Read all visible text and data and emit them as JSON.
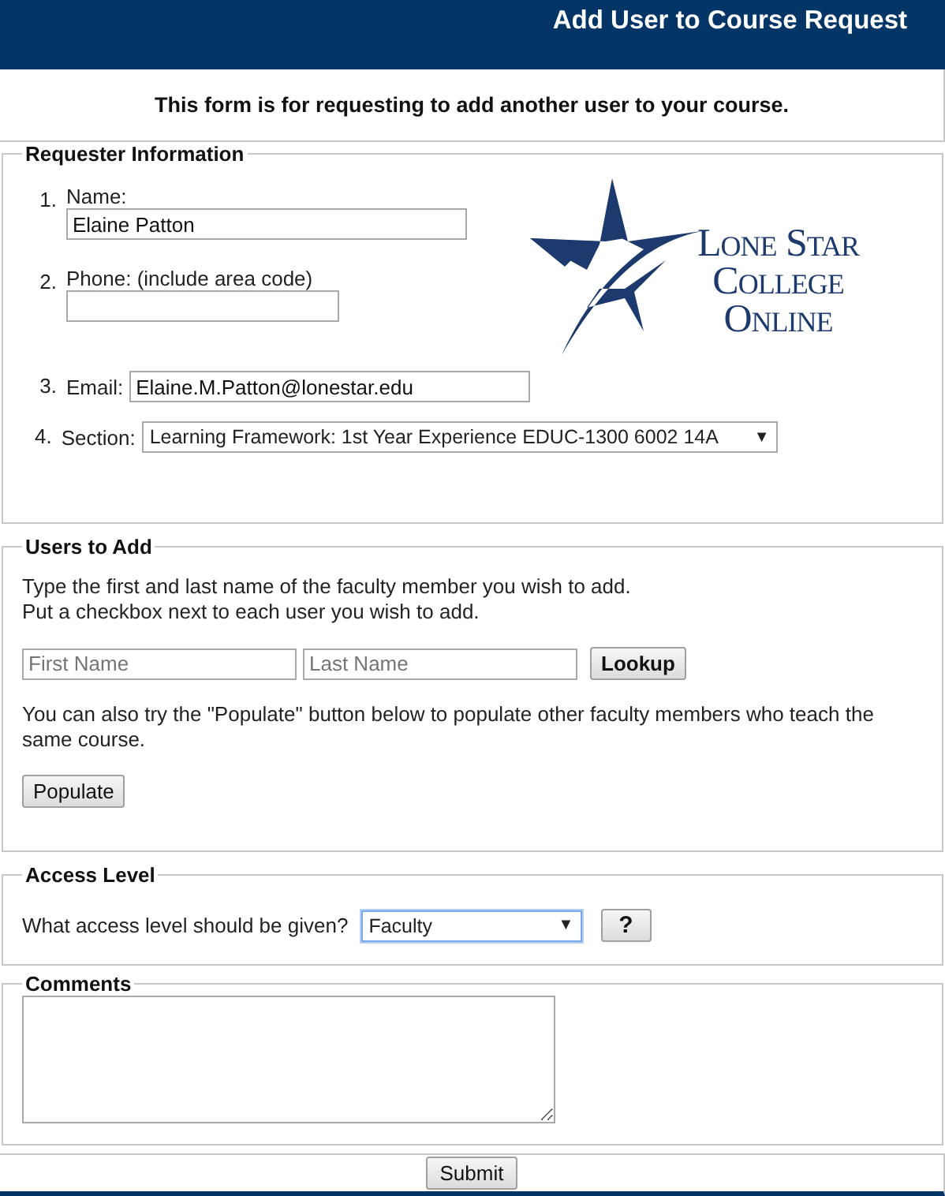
{
  "header": {
    "title": "Add User to Course Request"
  },
  "intro": "This form is for requesting to add another user to your course.",
  "requester": {
    "legend": "Requester Information",
    "fields": [
      {
        "number": "1.",
        "label": "Name:",
        "kind": "text-below",
        "value": "Elaine Patton"
      },
      {
        "number": "2.",
        "label": "Phone: (include area code)",
        "kind": "text-below-short"
      },
      {
        "number": "3.",
        "label": "Email:",
        "kind": "text-inline",
        "value": "Elaine.M.Patton@lonestar.edu"
      },
      {
        "number": "4.",
        "label": "Section:",
        "kind": "select",
        "value": "Learning Framework: 1st Year Experience EDUC-1300 6002 14A",
        "arrow": "▼"
      }
    ],
    "logo": {
      "lines": [
        "Lone Star",
        "College",
        "Online"
      ]
    }
  },
  "users": {
    "legend": "Users to Add",
    "instructions": [
      "Type the first and last name of the faculty member you wish to add.",
      "Put a checkbox next to each user you wish to add."
    ],
    "first_name": {
      "placeholder": "First Name"
    },
    "last_name": {
      "placeholder": "Last Name"
    },
    "lookup_button": "Lookup",
    "populate_text": "You can also try the \"Populate\" button below to populate other faculty members who teach the same course.",
    "populate_button": "Populate"
  },
  "access": {
    "legend": "Access Level",
    "question": "What access level should be given?",
    "value": "Faculty",
    "arrow": "▼",
    "focused": true,
    "help_button": "?"
  },
  "comments": {
    "legend": "Comments"
  },
  "submit_button": "Submit"
}
